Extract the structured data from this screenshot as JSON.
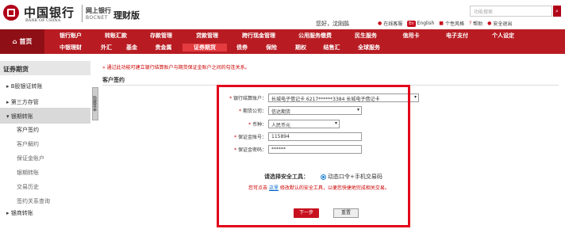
{
  "header": {
    "bank_name_cn": "中国银行",
    "bank_name_en": "BANK OF CHINA",
    "netbank_cn": "网上银行",
    "netbank_en": "BOCNET",
    "product": "理财版",
    "search_placeholder": "功能搜索",
    "greeting": "您好，",
    "username": "沈刚鹃",
    "top_links": [
      "在线客服",
      "English",
      "个性风格",
      "帮助",
      "安全退出"
    ],
    "en_badge": "En"
  },
  "nav": {
    "home": "首页",
    "row1": [
      "银行账户",
      "转账汇款",
      "存款管理",
      "贷款管理",
      "跨行现金管理",
      "公用服务缴费",
      "民生服务",
      "信用卡",
      "电子支付",
      "个人设定"
    ],
    "row2": [
      "中银理财",
      "外汇",
      "基金",
      "贵金属",
      "证券期货",
      "债券",
      "保险",
      "期权",
      "结售汇",
      "全球服务"
    ],
    "active": "证券期货"
  },
  "sidebar": {
    "title": "证券期货",
    "items": [
      {
        "label": "B股银证转账",
        "type": "parent",
        "collapsed": true
      },
      {
        "label": "第三方存管",
        "type": "parent",
        "collapsed": true
      },
      {
        "label": "银期转账",
        "type": "parent",
        "expanded": true
      },
      {
        "label": "客户签约",
        "type": "sub",
        "active": true
      },
      {
        "label": "客户解约",
        "type": "sub"
      },
      {
        "label": "保证金账户",
        "type": "sub"
      },
      {
        "label": "银期转账",
        "type": "sub"
      },
      {
        "label": "交易历史",
        "type": "sub"
      },
      {
        "label": "签约关系查询",
        "type": "sub"
      },
      {
        "label": "银商转账",
        "type": "parent",
        "collapsed": true
      }
    ],
    "collapse_label": "隐藏菜单"
  },
  "main": {
    "notice": "通过此功能可建立银行结算账户与期货保证金账户之间的勾连关系。",
    "title": "客户签约",
    "form": {
      "bank_account_label": "银行结算账户：",
      "bank_account_value": "长城电子借记卡 6217******3384 长城电子借记卡",
      "futures_company_label": "期货公司：",
      "futures_company_value": "信达期货",
      "currency_label": "币种：",
      "currency_value": "人民币元",
      "margin_account_label": "保证金账号：",
      "margin_account_value": "115894",
      "margin_password_label": "保证金密码：",
      "margin_password_value": "******"
    },
    "secure_tool_label": "请选择安全工具：",
    "secure_tool_value": "动态口令+手机交易码",
    "hint_pre": "您可点击",
    "hint_link": "这里",
    "hint_post": "修改默认的安全工具，以便您快捷地完成相关交易。",
    "next_button": "下一步",
    "reset_button": "重置"
  },
  "colors": {
    "brand_red": "#b81c22",
    "highlight_box": "#e2001a"
  }
}
